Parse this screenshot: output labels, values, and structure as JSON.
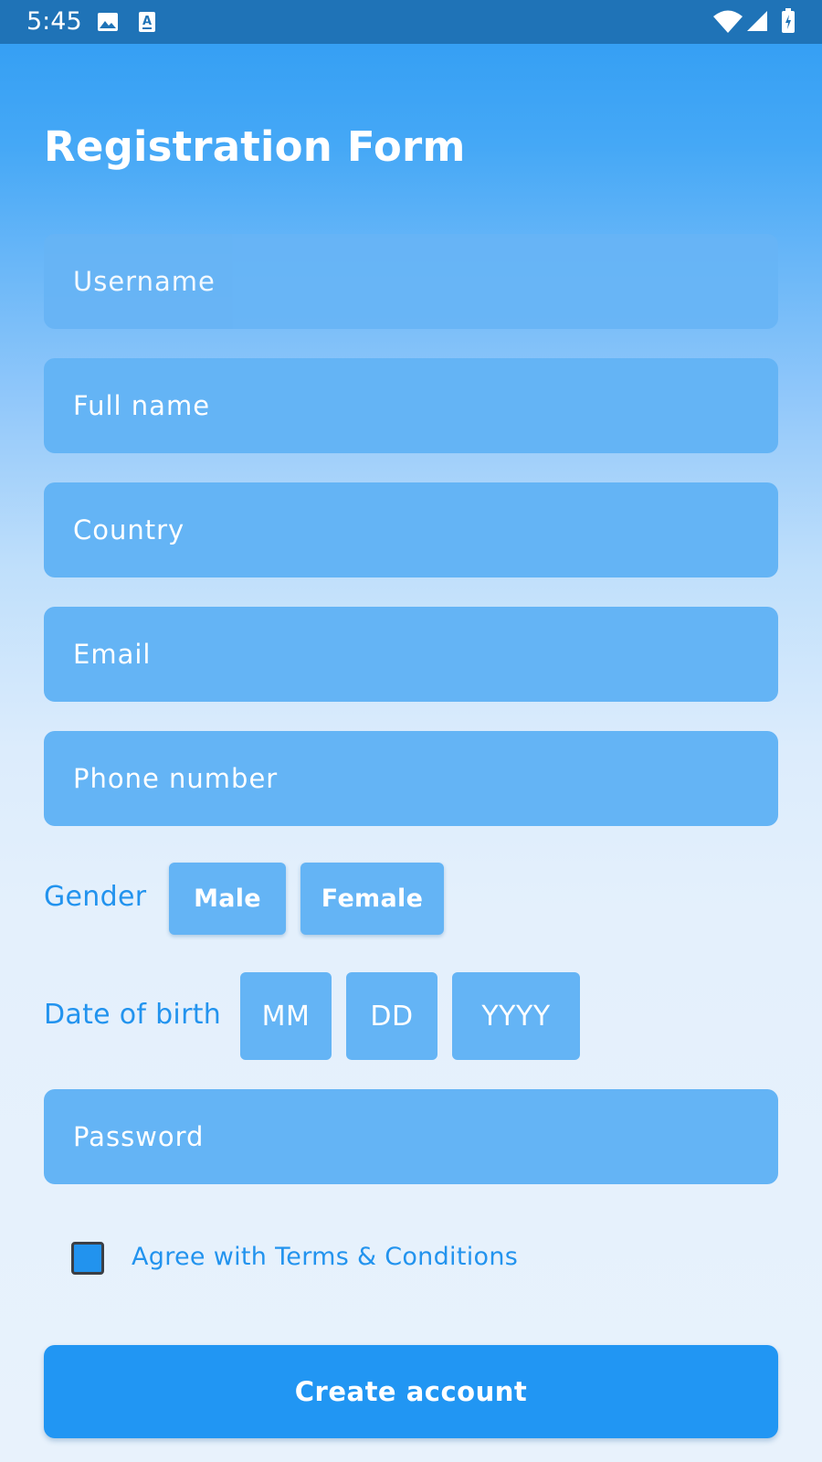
{
  "status_bar": {
    "time": "5:45",
    "left_icons": [
      "image-icon",
      "text-a-icon"
    ],
    "right_icons": [
      "wifi-icon",
      "signal-icon",
      "battery-icon"
    ]
  },
  "form": {
    "title": "Registration Form",
    "fields": {
      "username": "Username",
      "full_name": "Full name",
      "country": "Country",
      "email": "Email",
      "phone": "Phone number",
      "password": "Password"
    },
    "gender": {
      "label": "Gender",
      "options": [
        "Male",
        "Female"
      ]
    },
    "date_of_birth": {
      "label": "Date of birth",
      "month": "MM",
      "day": "DD",
      "year": "YYYY"
    },
    "terms": {
      "label": "Agree with Terms & Conditions",
      "checked": true
    },
    "submit_label": "Create account"
  },
  "colors": {
    "status_bar": "#1f73b7",
    "primary": "#2196f3",
    "field": "#64b4f5",
    "label_text": "#2293ee"
  }
}
